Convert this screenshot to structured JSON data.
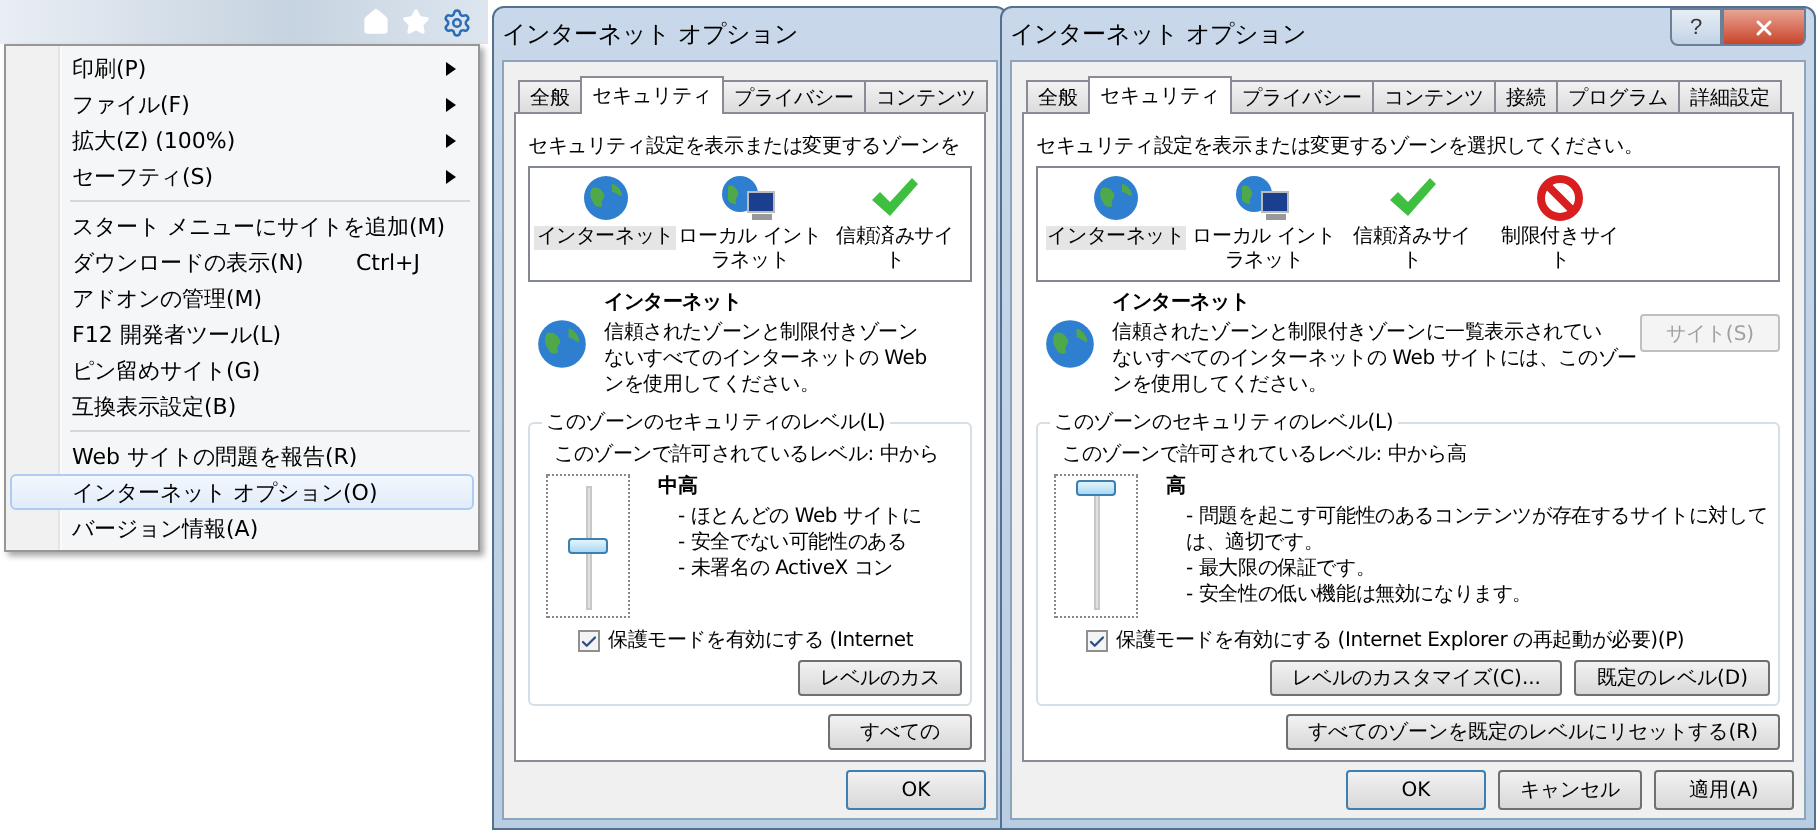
{
  "menu": {
    "sections": [
      {
        "items": [
          {
            "label": "印刷(P)",
            "kind": "submenu",
            "selected": false
          },
          {
            "label": "ファイル(F)",
            "kind": "submenu",
            "selected": false
          },
          {
            "label": "拡大(Z) (100%)",
            "kind": "submenu",
            "selected": false
          },
          {
            "label": "セーフティ(S)",
            "kind": "submenu",
            "selected": false
          }
        ]
      },
      {
        "items": [
          {
            "label": "スタート メニューにサイトを追加(M)",
            "kind": "plain",
            "selected": false
          },
          {
            "label": "ダウンロードの表示(N)",
            "kind": "shortcut",
            "shortcut": "Ctrl+J",
            "selected": false
          },
          {
            "label": "アドオンの管理(M)",
            "kind": "plain",
            "selected": false
          },
          {
            "label": "F12 開発者ツール(L)",
            "kind": "plain",
            "selected": false
          },
          {
            "label": "ピン留めサイト(G)",
            "kind": "plain",
            "selected": false
          },
          {
            "label": "互換表示設定(B)",
            "kind": "plain",
            "selected": false
          }
        ]
      },
      {
        "items": [
          {
            "label": "Web サイトの問題を報告(R)",
            "kind": "plain",
            "selected": false
          },
          {
            "label": "インターネット オプション(O)",
            "kind": "plain",
            "selected": true
          },
          {
            "label": "バージョン情報(A)",
            "kind": "plain",
            "selected": false
          }
        ]
      }
    ]
  },
  "dialogs": [
    {
      "title": "インターネット オプション",
      "tabs": [
        {
          "label": "全般",
          "selected": false
        },
        {
          "label": "セキュリティ",
          "selected": true
        },
        {
          "label": "プライバシー",
          "selected": false
        },
        {
          "label": "コンテンツ",
          "selected": false
        }
      ],
      "instruction": "セキュリティ設定を表示または変更するゾーンを",
      "zones": [
        {
          "kind": "internet",
          "label_lines": [
            "インターネット"
          ],
          "selected": true
        },
        {
          "kind": "intranet",
          "label_lines": [
            "ローカル イント",
            "ラネット"
          ],
          "selected": false
        },
        {
          "kind": "trusted",
          "label_lines": [
            "信頼済みサイ",
            "ト"
          ],
          "selected": false
        }
      ],
      "zone_heading": "インターネット",
      "description_lines": [
        "信頼されたゾーンと制限付きゾーン",
        "ないすべてのインターネットの Web",
        "ンを使用してください。"
      ],
      "level_group": {
        "label": "このゾーンのセキュリティのレベル(L)",
        "allowed": "このゾーンで許可されているレベル: 中から",
        "level_name": "中高",
        "level": 0.5,
        "bullets": [
          "- ほとんどの Web サイトに",
          "- 安全でない可能性のある",
          "- 未署名の ActiveX コン"
        ],
        "protected_mode": {
          "label": "保護モードを有効にする (Internet",
          "checked": true
        },
        "buttons": [
          "レベルのカス"
        ]
      },
      "reset_button": "すべての",
      "footer_buttons": [
        {
          "label": "OK",
          "default": true
        }
      ]
    },
    {
      "title": "インターネット オプション",
      "title_buttons": [
        {
          "kind": "help",
          "label": "?"
        },
        {
          "kind": "close"
        }
      ],
      "tabs": [
        {
          "label": "全般",
          "selected": false
        },
        {
          "label": "セキュリティ",
          "selected": true
        },
        {
          "label": "プライバシー",
          "selected": false
        },
        {
          "label": "コンテンツ",
          "selected": false
        },
        {
          "label": "接続",
          "selected": false
        },
        {
          "label": "プログラム",
          "selected": false
        },
        {
          "label": "詳細設定",
          "selected": false
        }
      ],
      "instruction": "セキュリティ設定を表示または変更するゾーンを選択してください。",
      "zones": [
        {
          "kind": "internet",
          "label_lines": [
            "インターネット"
          ],
          "selected": true
        },
        {
          "kind": "intranet",
          "label_lines": [
            "ローカル イント",
            "ラネット"
          ],
          "selected": false
        },
        {
          "kind": "trusted",
          "label_lines": [
            "信頼済みサイ",
            "ト"
          ],
          "selected": false
        },
        {
          "kind": "restricted",
          "label_lines": [
            "制限付きサイ",
            "ト"
          ],
          "selected": false
        }
      ],
      "zone_heading": "インターネット",
      "description_lines": [
        "信頼されたゾーンと制限付きゾーンに一覧表示されてい",
        "ないすべてのインターネットの Web サイトには、このゾー",
        "ンを使用してください。"
      ],
      "site_button": {
        "label": "サイト(S)",
        "disabled": true
      },
      "level_group": {
        "label": "このゾーンのセキュリティのレベル(L)",
        "allowed": "このゾーンで許可されているレベル: 中から高",
        "level_name": "高",
        "level": 1,
        "bullets": [
          "- 問題を起こす可能性のあるコンテンツが存在するサイトに対しては、適切です。",
          "- 最大限の保証です。",
          "- 安全性の低い機能は無効になります。"
        ],
        "protected_mode": {
          "label": "保護モードを有効にする (Internet Explorer の再起動が必要)(P)",
          "checked": true
        },
        "buttons": [
          "レベルのカスタマイズ(C)...",
          "既定のレベル(D)"
        ]
      },
      "reset_button": "すべてのゾーンを既定のレベルにリセットする(R)",
      "footer_buttons": [
        {
          "label": "OK",
          "default": true
        },
        {
          "label": "キャンセル",
          "default": false
        },
        {
          "label": "適用(A)",
          "default": false
        }
      ]
    }
  ]
}
